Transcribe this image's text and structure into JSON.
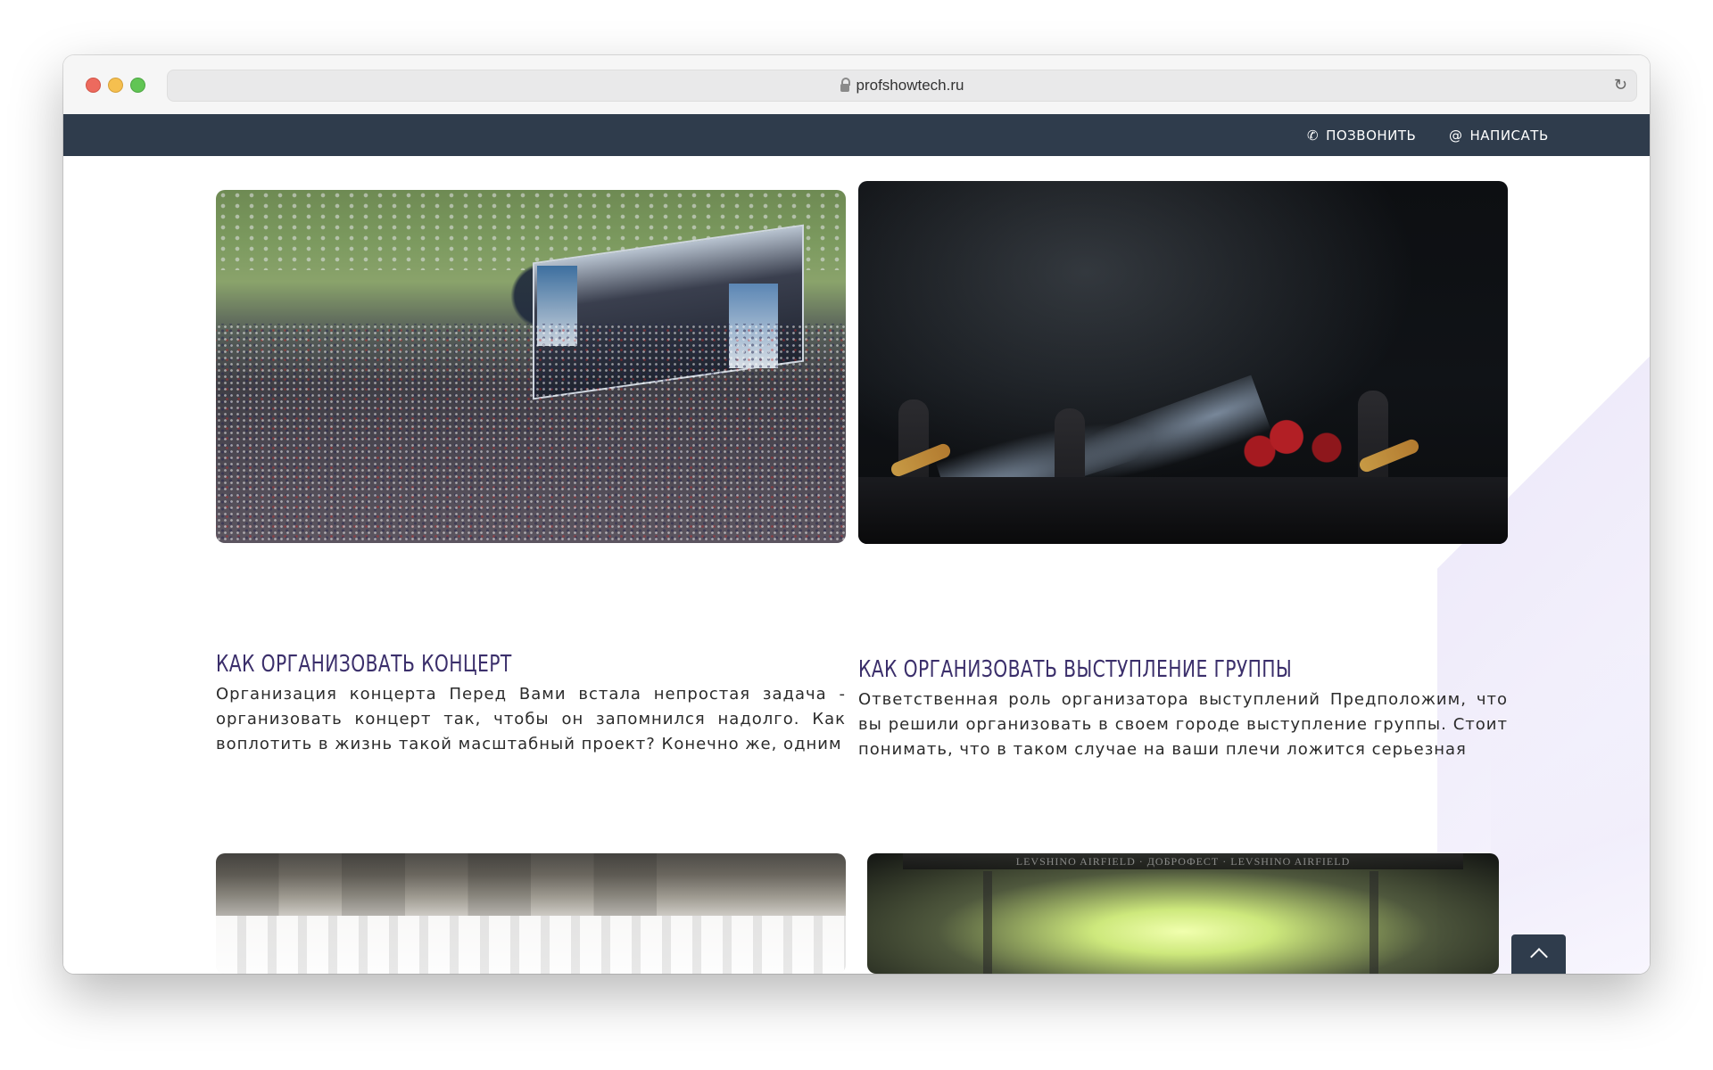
{
  "browser": {
    "url": "profshowtech.ru"
  },
  "header": {
    "call_label": "ПОЗВОНИТЬ",
    "write_label": "НАПИСАТЬ"
  },
  "articles": [
    {
      "title": "КАК ОРГАНИЗОВАТЬ КОНЦЕРТ",
      "excerpt": "Организация концерта Перед Вами встала непростая задача - организовать концерт так, чтобы он запомнился надолго. Как воплотить в жизнь такой масштабный проект? Конечно же, одним"
    },
    {
      "title": "КАК ОРГАНИЗОВАТЬ ВЫСТУПЛЕНИЕ ГРУППЫ",
      "excerpt": "Ответственная роль организатора выступлений Предположим, что вы решили организовать в своем городе выступление группы. Стоит понимать, что в таком случае на ваши плечи ложится серьезная"
    }
  ],
  "images": {
    "festival_banner_text": "ДОБРОФЕСТ",
    "festival_truss_text": "LEVSHINO AIRFIELD · ДОБРОФЕСТ · LEVSHINO AIRFIELD"
  },
  "theme": {
    "nav_bg": "#2f3c4c",
    "title_color": "#3b2f6b",
    "text_color": "#2b2b2b"
  },
  "icons": {
    "call": "phone-icon",
    "write": "at-sign-icon",
    "back_to_top": "chevron-up-icon"
  }
}
